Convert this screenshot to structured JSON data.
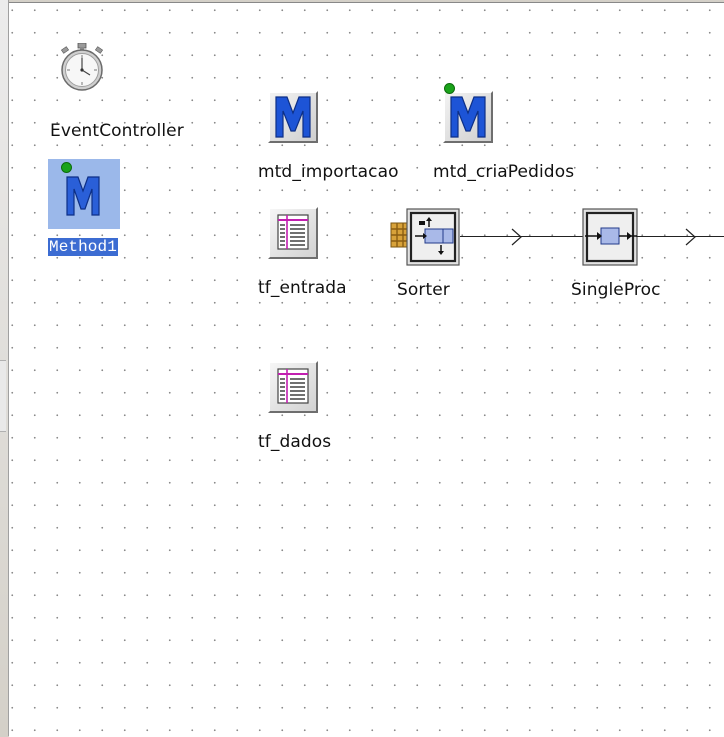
{
  "canvas": {
    "objects": {
      "event_controller": {
        "label": "EventController",
        "icon": "stopwatch-icon"
      },
      "method1": {
        "label": "Method1",
        "icon": "method-icon",
        "selected": true,
        "active": true
      },
      "mtd_importacao": {
        "label": "mtd_importacao",
        "icon": "method-icon"
      },
      "mtd_criapedidos": {
        "label": "mtd_criaPedidos",
        "icon": "method-icon",
        "active": true
      },
      "tf_entrada": {
        "label": "tf_entrada",
        "icon": "table-file-icon"
      },
      "tf_dados": {
        "label": "tf_dados",
        "icon": "table-file-icon"
      },
      "sorter": {
        "label": "Sorter",
        "icon": "sorter-icon"
      },
      "singleproc": {
        "label": "SingleProc",
        "icon": "singleproc-icon"
      }
    }
  },
  "colors": {
    "selection": "#3c6cd2",
    "method_blue": "#1d54d6",
    "active_indicator": "#1aa31a",
    "grid_dot": "#8a8a8a"
  }
}
